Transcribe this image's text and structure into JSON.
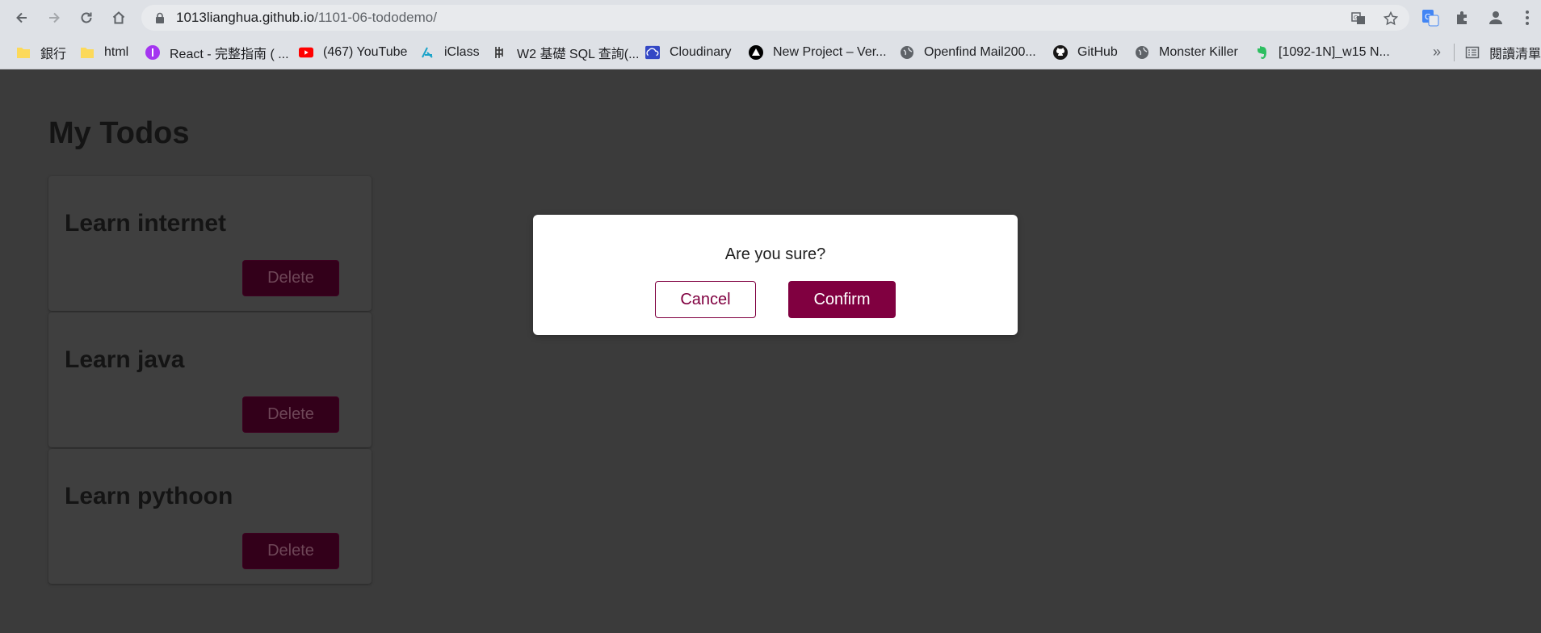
{
  "browser": {
    "url_host": "1013lianghua.github.io",
    "url_path": "/1101-06-tododemo/",
    "bookmarks": [
      {
        "label": "銀行",
        "icon": "folder-icon"
      },
      {
        "label": "html",
        "icon": "folder-icon"
      },
      {
        "label": "React - 完整指南 ( ...",
        "icon": "react-guide-icon"
      },
      {
        "label": "(467) YouTube",
        "icon": "youtube-icon"
      },
      {
        "label": "iClass",
        "icon": "iclass-icon"
      },
      {
        "label": "W2 基礎 SQL 查詢(...",
        "icon": "w2-icon"
      },
      {
        "label": "Cloudinary",
        "icon": "cloudinary-icon"
      },
      {
        "label": "New Project – Ver...",
        "icon": "vercel-icon"
      },
      {
        "label": "Openfind Mail200...",
        "icon": "globe-icon"
      },
      {
        "label": "GitHub",
        "icon": "github-icon"
      },
      {
        "label": "Monster Killer",
        "icon": "globe-icon"
      },
      {
        "label": "[1092-1N]_w15 N...",
        "icon": "evernote-icon"
      }
    ],
    "more_label": "»",
    "reading_list_label": "閱讀清單"
  },
  "page": {
    "title": "My Todos",
    "todos": [
      {
        "text": "Learn internet",
        "delete_label": "Delete"
      },
      {
        "text": "Learn java",
        "delete_label": "Delete"
      },
      {
        "text": "Learn pythoon",
        "delete_label": "Delete"
      }
    ]
  },
  "modal": {
    "message": "Are you sure?",
    "cancel_label": "Cancel",
    "confirm_label": "Confirm"
  },
  "colors": {
    "accent": "#800040",
    "backdrop": "#3b3b3b"
  }
}
